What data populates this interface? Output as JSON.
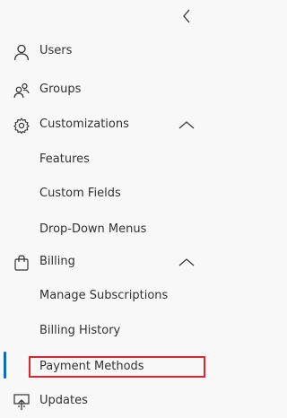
{
  "header": {
    "collapse_icon": "chevron-left-icon"
  },
  "nav": {
    "users": {
      "label": "Users",
      "icon": "person-icon"
    },
    "groups": {
      "label": "Groups",
      "icon": "people-icon"
    },
    "customizations": {
      "label": "Customizations",
      "icon": "gear-icon",
      "expanded": true,
      "children": [
        "Features",
        "Custom Fields",
        "Drop-Down Menus"
      ]
    },
    "billing": {
      "label": "Billing",
      "icon": "bag-icon",
      "expanded": true,
      "children": [
        "Manage Subscriptions",
        "Billing History",
        "Payment Methods"
      ]
    },
    "updates": {
      "label": "Updates",
      "icon": "monitor-update-icon"
    },
    "active_item": "Payment Methods"
  },
  "colors": {
    "accent": "#0f6cbd",
    "highlight_box": "#e0232e",
    "text": "#323130"
  }
}
